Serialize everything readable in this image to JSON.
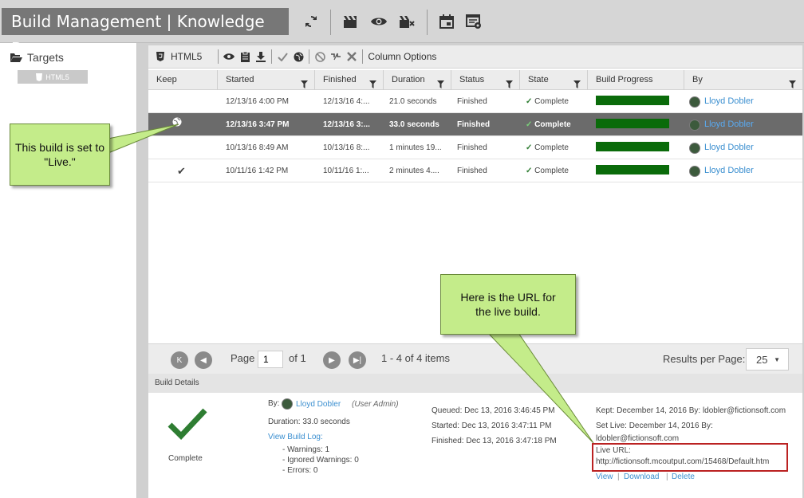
{
  "app": {
    "title": "Build Management | Knowledge Base"
  },
  "left": {
    "targets_label": "Targets",
    "target_item": "HTML5"
  },
  "toolbar": {
    "target_name": "HTML5",
    "column_options": "Column Options"
  },
  "columns": [
    "Keep",
    "Started",
    "Finished",
    "Duration",
    "Status",
    "State",
    "Build Progress",
    "By"
  ],
  "rows": [
    {
      "started": "12/13/16 4:00 PM",
      "finished": "12/13/16 4:...",
      "duration": "21.0 seconds",
      "status": "Finished",
      "state": "Complete",
      "by": "Lloyd Dobler",
      "keep": "",
      "progress": 1.0
    },
    {
      "started": "12/13/16 3:47 PM",
      "finished": "12/13/16 3:...",
      "duration": "33.0 seconds",
      "status": "Finished",
      "state": "Complete",
      "by": "Lloyd Dobler",
      "keep": "live",
      "progress": 1.0
    },
    {
      "started": "10/13/16 8:49 AM",
      "finished": "10/13/16 8:...",
      "duration": "1 minutes 19...",
      "status": "Finished",
      "state": "Complete",
      "by": "Lloyd Dobler",
      "keep": "",
      "progress": 1.0
    },
    {
      "started": "10/11/16 1:42 PM",
      "finished": "10/11/16 1:...",
      "duration": "2 minutes 4....",
      "status": "Finished",
      "state": "Complete",
      "by": "Lloyd Dobler",
      "keep": "kept",
      "progress": 1.0
    }
  ],
  "pager": {
    "page_label": "Page",
    "page_value": "1",
    "of_label": "of 1",
    "items_label": "1 - 4 of 4 items",
    "rpp_label": "Results per Page:",
    "rpp_value": "25"
  },
  "details": {
    "header": "Build Details",
    "state": "Complete",
    "by_label": "By:",
    "by_name": "Lloyd Dobler",
    "by_role": "(User Admin)",
    "duration": "Duration: 33.0 seconds",
    "view_log": "View Build Log:",
    "warnings": "- Warnings: 1",
    "ignored": "- Ignored Warnings: 0",
    "errors": "- Errors: 0",
    "queued": "Queued: Dec 13, 2016 3:46:45 PM",
    "started": "Started: Dec 13, 2016 3:47:11 PM",
    "finished": "Finished: Dec 13, 2016 3:47:18 PM",
    "kept": "Kept: December 14, 2016 By: ldobler@fictionsoft.com",
    "set_live": "Set Live: December 14, 2016 By:",
    "set_live_email": "ldobler@fictionsoft.com",
    "live_url_label": "Live URL:",
    "live_url": "http://fictionsoft.mcoutput.com/15468/Default.htm",
    "view": "View",
    "download": "Download",
    "delete": "Delete"
  },
  "callouts": {
    "live": "This build is set to \"Live.\"",
    "url": "Here is the URL for the live build."
  },
  "colors": {
    "progress": "#0a6b0a",
    "callout": "#c4ec8a",
    "check": "#2e7d32",
    "link": "#3b8fd0"
  }
}
